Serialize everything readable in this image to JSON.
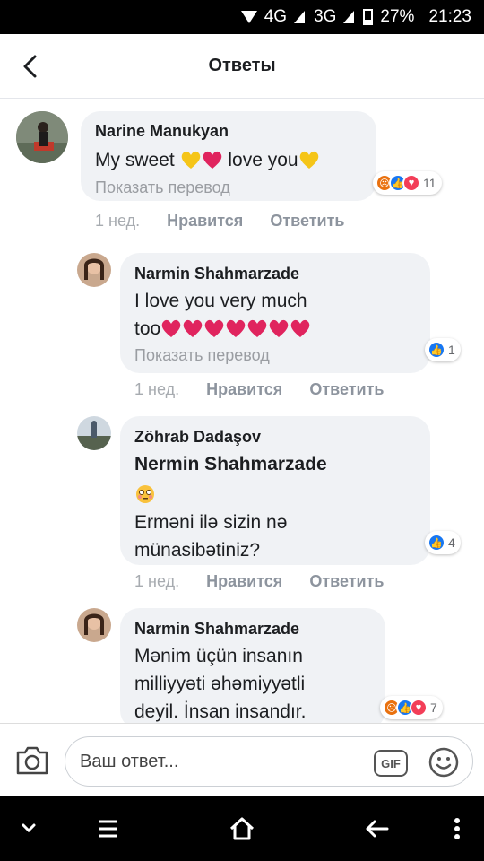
{
  "status_bar": {
    "network1": "4G",
    "network2": "3G",
    "battery": "27%",
    "time": "21:23"
  },
  "header": {
    "title": "Ответы"
  },
  "comments": [
    {
      "author": "Narine Manukyan",
      "text_before": "My sweet ",
      "text_after": " love you",
      "translate": "Показать перевод",
      "time": "1 нед.",
      "like": "Нравится",
      "reply": "Ответить",
      "reactions": [
        "angry",
        "like",
        "heart"
      ],
      "reaction_count": "11"
    },
    {
      "author": "Narmin Shahmarzade",
      "text_line1": "I love you very much",
      "text_line2": "too",
      "translate": "Показать перевод",
      "time": "1 нед.",
      "like": "Нравится",
      "reply": "Ответить",
      "reactions": [
        "like"
      ],
      "reaction_count": "1"
    },
    {
      "author": "Zöhrab Dadaşov",
      "tag": "Nermin Shahmarzade",
      "text_line1": "Erməni ilə sizin nə",
      "text_line2": "münasibətiniz?",
      "time": "1 нед.",
      "like": "Нравится",
      "reply": "Ответить",
      "reactions": [
        "like"
      ],
      "reaction_count": "4"
    },
    {
      "author": "Narmin Shahmarzade",
      "text_line1": "Mənim üçün insanın",
      "text_line2": "milliyyəti əhəmiyyətli",
      "text_line3": "deyil. İnsan insandır.",
      "reactions": [
        "angry",
        "like",
        "heart"
      ],
      "reaction_count": "7"
    }
  ],
  "composer": {
    "placeholder": "Ваш ответ...",
    "gif_label": "GIF"
  },
  "icons": {
    "back": "chevron-left-icon",
    "camera": "camera-icon",
    "emoji": "smiley-icon",
    "nav": [
      "chevron-down-icon",
      "menu-icon",
      "home-icon",
      "back-arrow-icon",
      "more-vertical-icon"
    ]
  },
  "colors": {
    "like": "#1877f2",
    "angry": "#e9710f",
    "heart": "#f33e58",
    "bubble": "#f0f2f5"
  }
}
